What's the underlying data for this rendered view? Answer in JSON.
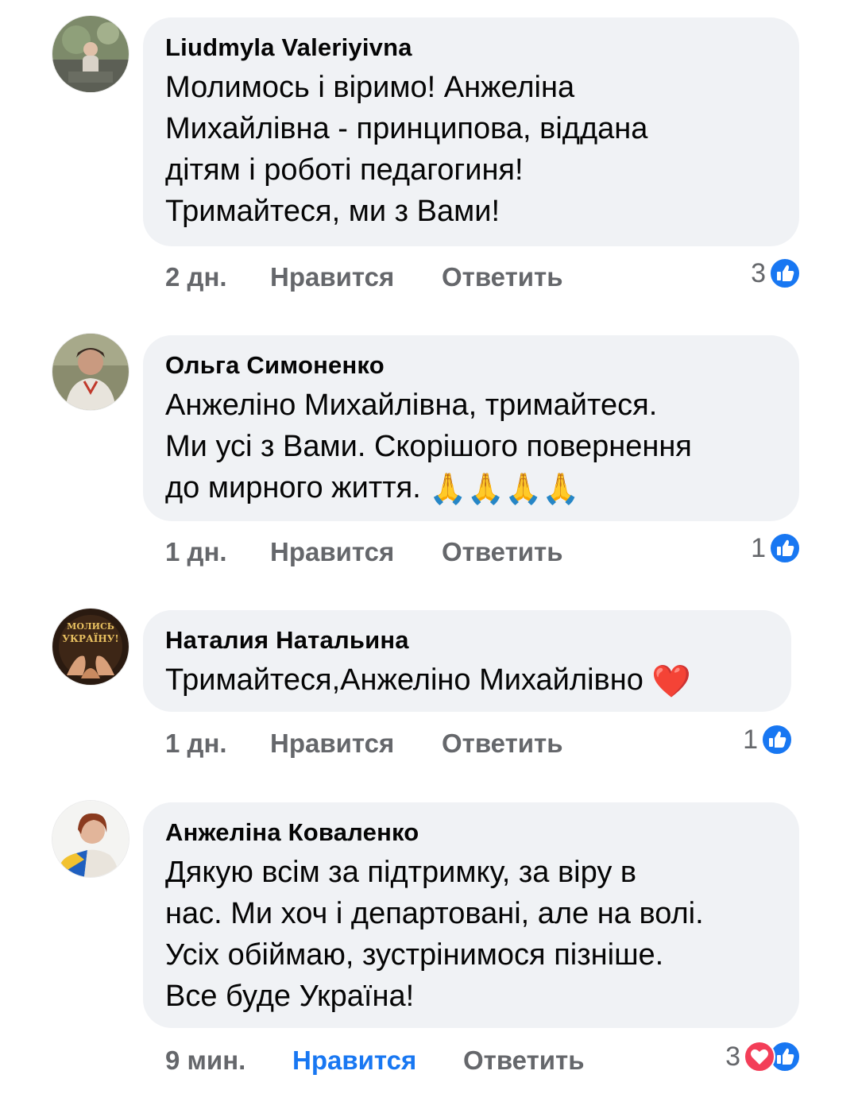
{
  "colors": {
    "bubble": "#f0f2f5",
    "meta_text": "#65676b",
    "like_active": "#1877f2",
    "like_icon": "#1877f2",
    "love_icon": "#f33e58"
  },
  "comments": [
    {
      "author": "Liudmyla Valeriyivna",
      "text": "Молимось і віримо! Анжеліна\nМихайлівна - принципова, віддана\nдітям і роботі педагогиня!\nТримайтеся, ми з Вами!",
      "time": "2 дн.",
      "like_label": "Нравится",
      "reply_label": "Ответить",
      "reaction_count": "3",
      "reactions": [
        "like-icon"
      ]
    },
    {
      "author": "Ольга Симоненко",
      "text": "Анжеліно Михайлівна,  тримайтеся.\nМи усі з Вами. Скорішого повернення\nдо мирного  життя. ",
      "emoji": "🙏🙏🙏🙏",
      "time": "1 дн.",
      "like_label": "Нравится",
      "reply_label": "Ответить",
      "reaction_count": "1",
      "reactions": [
        "like-icon"
      ]
    },
    {
      "author": "Наталия Натальина",
      "avatar_text": "МОЛИСЬ ЗА УКРАЇНУ!",
      "text": "Тримайтеся,Анжеліно Михайлівно ",
      "emoji": "❤️",
      "time": "1 дн.",
      "like_label": "Нравится",
      "reply_label": "Ответить",
      "reaction_count": "1",
      "reactions": [
        "like-icon"
      ]
    },
    {
      "author": "Анжеліна Коваленко",
      "text": "Дякую всім за підтримку, за віру в\nнас. Ми хоч і департовані, але на волі.\nУсіх обіймаю, зустрінимося пізніше.\nВсе буде Україна!",
      "time": "9 мин.",
      "like_label": "Нравится",
      "like_active": true,
      "reply_label": "Ответить",
      "reaction_count": "3",
      "reactions": [
        "love-icon",
        "like-icon"
      ]
    }
  ]
}
